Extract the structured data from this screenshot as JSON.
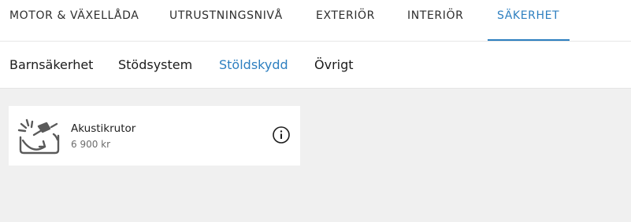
{
  "top_tabs": [
    {
      "label": "MOTOR & VÄXELLÅDA",
      "active": false
    },
    {
      "label": "UTRUSTNINGSNIVÅ",
      "active": false
    },
    {
      "label": "EXTERIÖR",
      "active": false
    },
    {
      "label": "INTERIÖR",
      "active": false
    },
    {
      "label": "SÄKERHET",
      "active": true
    }
  ],
  "sub_tabs": [
    {
      "label": "Barnsäkerhet",
      "active": false
    },
    {
      "label": "Stödsystem",
      "active": false
    },
    {
      "label": "Stöldskydd",
      "active": true
    },
    {
      "label": "Övrigt",
      "active": false
    }
  ],
  "options": [
    {
      "title": "Akustikrutor",
      "price": "6 900 kr",
      "icon": "acoustic-glass-icon",
      "info_icon": "info-icon"
    }
  ],
  "colors": {
    "accent": "#2d7fc0",
    "background": "#f0f0f0",
    "surface": "#ffffff",
    "icon": "#5a5a5a"
  }
}
